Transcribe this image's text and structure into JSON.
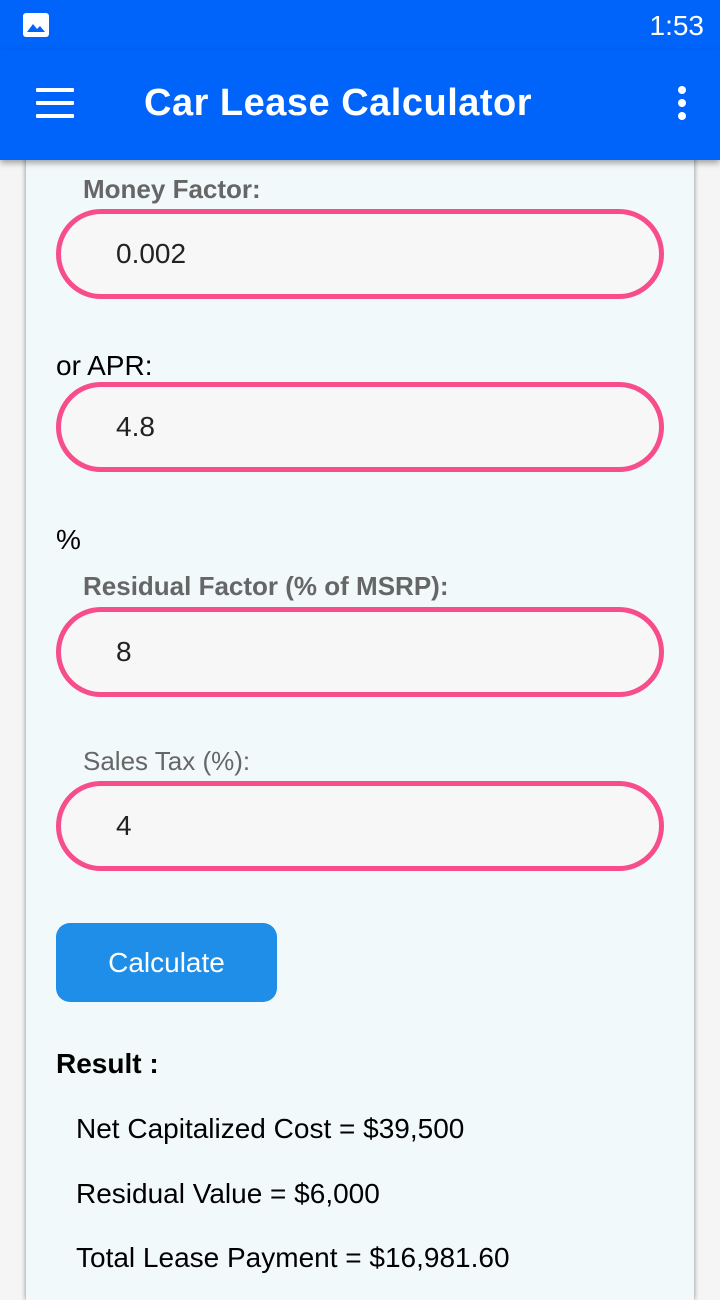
{
  "status_bar": {
    "time": "1:53",
    "icon": "image-icon"
  },
  "app_bar": {
    "title": "Car Lease Calculator",
    "menu_icon": "hamburger-menu-icon",
    "overflow_icon": "more-vert-icon"
  },
  "form": {
    "money_factor": {
      "label": "Money Factor:",
      "value": "0.002"
    },
    "apr": {
      "label": "or APR:",
      "value": "4.8",
      "suffix": "%"
    },
    "residual_factor": {
      "label": "Residual Factor (% of MSRP):",
      "value": "8"
    },
    "sales_tax": {
      "label": "Sales Tax (%):",
      "value": "4"
    },
    "calculate_label": "Calculate"
  },
  "result": {
    "title": "Result :",
    "lines": [
      "Net Capitalized Cost = $39,500",
      "Residual Value = $6,000",
      "Total Lease Payment = $16,981.60"
    ]
  },
  "colors": {
    "primary": "#0064fa",
    "input_border": "#f74d8a",
    "button": "#1e8ee8"
  }
}
